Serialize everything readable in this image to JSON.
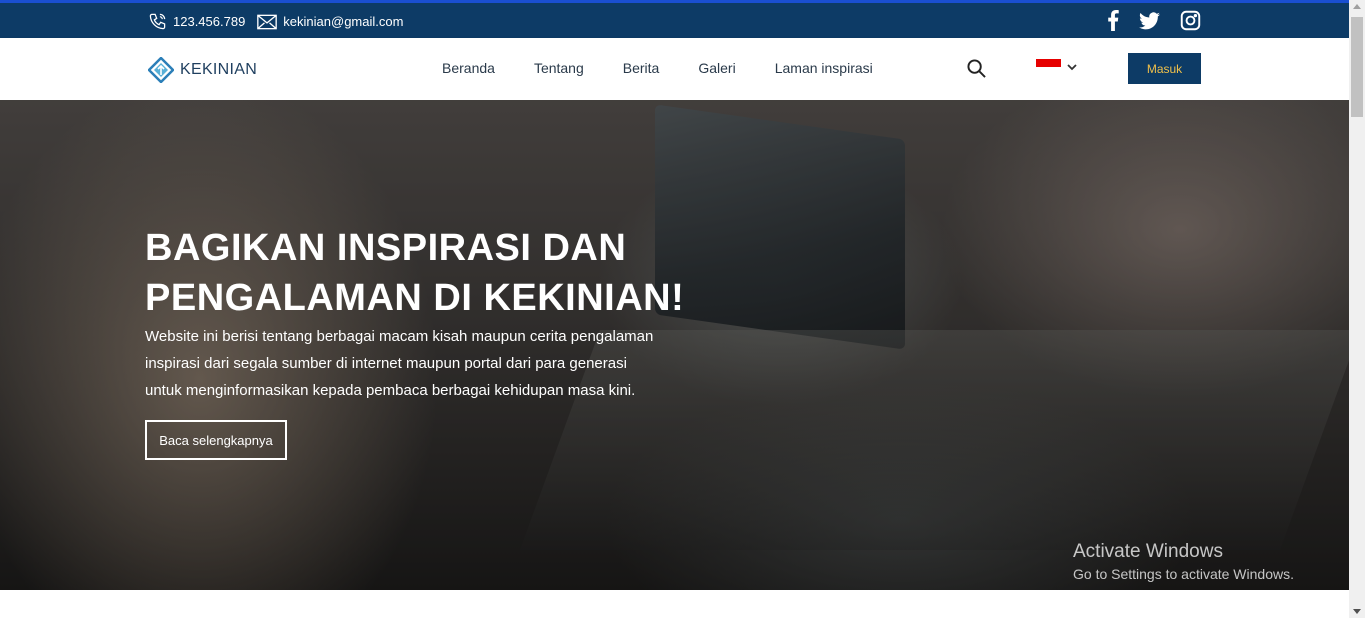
{
  "topbar": {
    "phone": "123.456.789",
    "email": "kekinian@gmail.com",
    "social": [
      "facebook-icon",
      "twitter-icon",
      "instagram-icon"
    ],
    "background": "#0d3b66"
  },
  "header": {
    "brand": "KEKINIAN",
    "nav": [
      "Beranda",
      "Tentang",
      "Berita",
      "Galeri",
      "Laman inspirasi"
    ],
    "language_flag": "Indonesia",
    "login_label": "Masuk",
    "login_bg": "#0d3b66",
    "login_text_color": "#f0c04a"
  },
  "hero": {
    "title_line1": "BAGIKAN INSPIRASI DAN",
    "title_line2": "PENGALAMAN DI KEKINIAN!",
    "description": "Website ini berisi tentang berbagai macam kisah maupun cerita pengalaman inspirasi dari segala sumber di internet maupun portal dari para generasi untuk menginformasikan kepada pembaca berbagai kehidupan masa kini.",
    "cta_label": "Baca selengkapnya"
  },
  "watermark": {
    "line1": "Activate Windows",
    "line2": "Go to Settings to activate Windows."
  }
}
